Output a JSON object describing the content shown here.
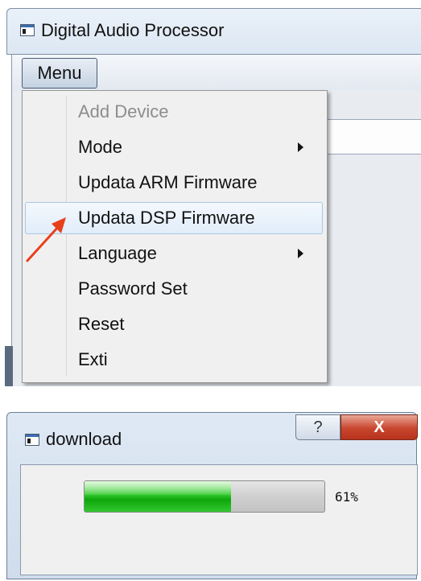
{
  "main_window": {
    "title": "Digital Audio Processor",
    "menu_label": "Menu",
    "menu_items": [
      {
        "label": "Add Device",
        "disabled": true,
        "submenu": false
      },
      {
        "label": "Mode",
        "disabled": false,
        "submenu": true
      },
      {
        "label": "Updata ARM Firmware",
        "disabled": false,
        "submenu": false
      },
      {
        "label": "Updata DSP Firmware",
        "disabled": false,
        "submenu": false,
        "highlighted": true
      },
      {
        "label": "Language",
        "disabled": false,
        "submenu": true
      },
      {
        "label": "Password Set",
        "disabled": false,
        "submenu": false
      },
      {
        "label": "Reset",
        "disabled": false,
        "submenu": false
      },
      {
        "label": "Exti",
        "disabled": false,
        "submenu": false
      }
    ]
  },
  "download_dialog": {
    "title": "download",
    "help_label": "?",
    "close_label": "X",
    "progress_value": 61,
    "progress_text": "61%"
  },
  "colors": {
    "annotation_arrow": "#e8401c",
    "progress_green": "#0ea70a",
    "close_red": "#c8452e"
  },
  "icons": [
    "app-window-icon",
    "submenu-arrow-icon",
    "annotation-arrow-icon",
    "help-icon",
    "close-icon"
  ]
}
